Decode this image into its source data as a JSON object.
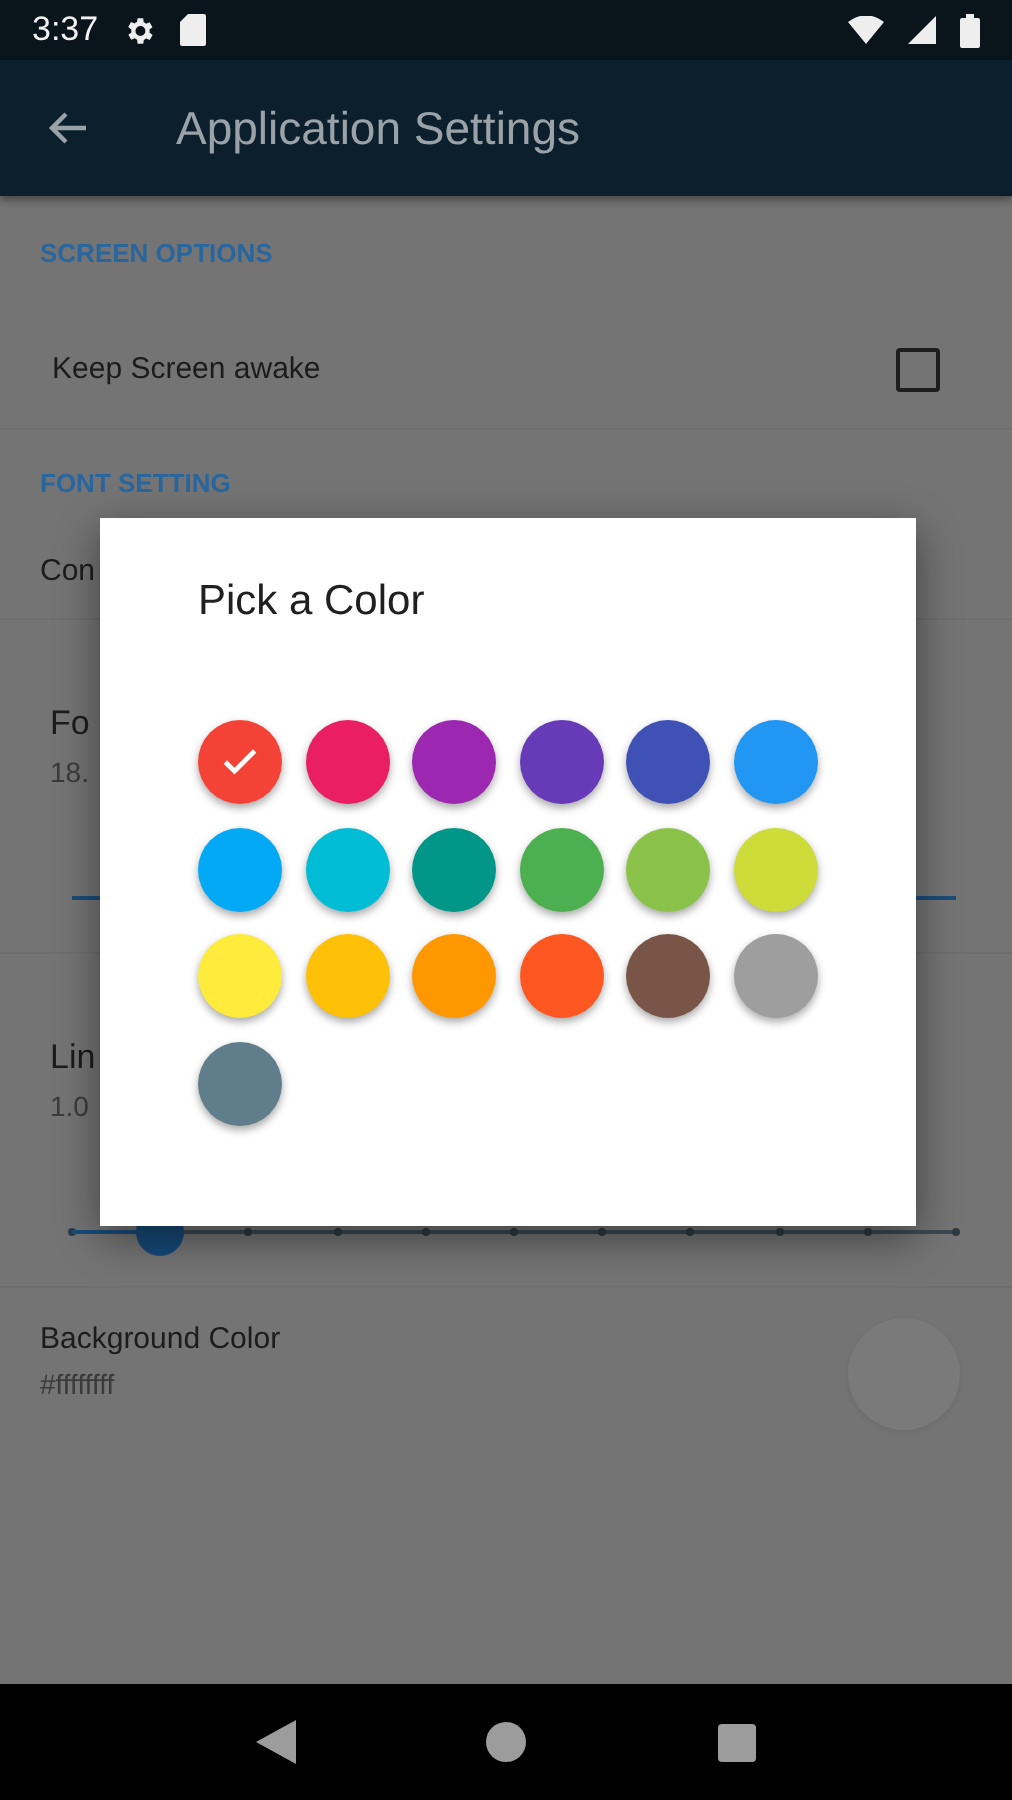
{
  "status_bar": {
    "time": "3:37"
  },
  "app_bar": {
    "title": "Application Settings"
  },
  "settings": [
    {
      "kind": "header",
      "text": "SCREEN OPTIONS"
    },
    {
      "kind": "checkbox",
      "title": "Keep Screen awake",
      "checked": false
    },
    {
      "kind": "header",
      "text": "FONT SETTING"
    },
    {
      "kind": "text",
      "title": "Con"
    },
    {
      "kind": "slider",
      "title": "Fo",
      "value": "18."
    },
    {
      "kind": "slider",
      "title": "Lin",
      "value": "1.0",
      "level": 0.1
    },
    {
      "kind": "color",
      "title": "Background Color",
      "value": "#ffffffff"
    }
  ],
  "dialog": {
    "title": "Pick a Color",
    "colors": [
      {
        "color": "#f44336",
        "selected": true
      },
      {
        "color": "#e91e63",
        "selected": false
      },
      {
        "color": "#9c27b0",
        "selected": false
      },
      {
        "color": "#673ab7",
        "selected": false
      },
      {
        "color": "#3f51b5",
        "selected": false
      },
      {
        "color": "#2196f3",
        "selected": false
      },
      {
        "color": "#03a9f4",
        "selected": false
      },
      {
        "color": "#00bcd4",
        "selected": false
      },
      {
        "color": "#009688",
        "selected": false
      },
      {
        "color": "#4caf50",
        "selected": false
      },
      {
        "color": "#8bc34a",
        "selected": false
      },
      {
        "color": "#cddc39",
        "selected": false
      },
      {
        "color": "#ffeb3b",
        "selected": false
      },
      {
        "color": "#ffc107",
        "selected": false
      },
      {
        "color": "#ff9800",
        "selected": false
      },
      {
        "color": "#ff5722",
        "selected": false
      },
      {
        "color": "#795548",
        "selected": false
      },
      {
        "color": "#9e9e9e",
        "selected": false
      },
      {
        "color": "#607d8b",
        "selected": false
      }
    ]
  }
}
